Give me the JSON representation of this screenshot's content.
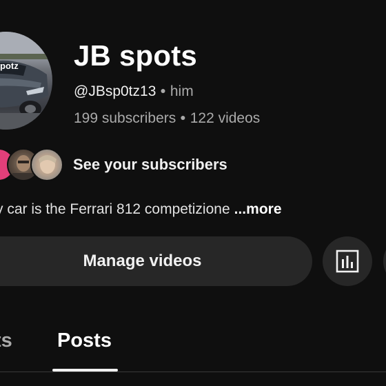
{
  "channel": {
    "name": "JB spots",
    "handle": "@JBsp0tz13",
    "pronouns": "him",
    "subscribers": "199 subscribers",
    "videos": "122 videos",
    "avatar_overlay_text": "potz",
    "avatar_icon": "car-photo"
  },
  "subscribers_preview": {
    "link_label": "See your subscribers"
  },
  "description": {
    "text": "y car is the Ferrari 812 competizione",
    "more_label": "...more"
  },
  "actions": {
    "manage_label": "Manage videos",
    "analytics_icon": "analytics-icon"
  },
  "tabs": [
    {
      "label": "ts",
      "selected": false
    },
    {
      "label": "Posts",
      "selected": true
    }
  ],
  "colors": {
    "background": "#0f0f0f",
    "button_bg": "#272727",
    "secondary_text": "#aaaaaa",
    "primary_text": "#f1f1f1",
    "accent_avatar": "#e33f7a"
  }
}
